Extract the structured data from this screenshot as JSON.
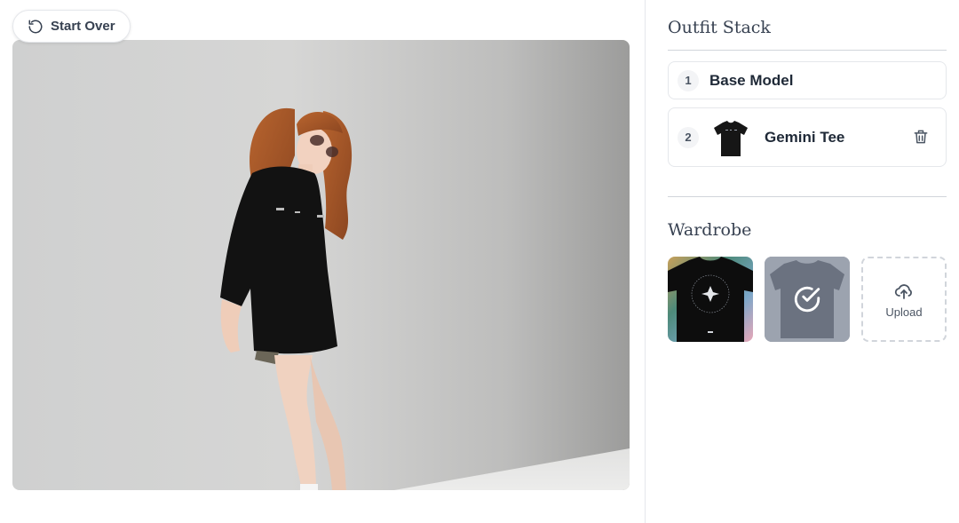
{
  "toolbar": {
    "start_over_label": "Start Over"
  },
  "outfit_stack": {
    "title": "Outfit Stack",
    "items": [
      {
        "index": "1",
        "label": "Base Model"
      },
      {
        "index": "2",
        "label": "Gemini Tee"
      }
    ]
  },
  "wardrobe": {
    "title": "Wardrobe",
    "upload_label": "Upload"
  },
  "colors": {
    "accent": "#1f2937",
    "border": "#e5e7eb",
    "selected_overlay": "#6b7280"
  }
}
